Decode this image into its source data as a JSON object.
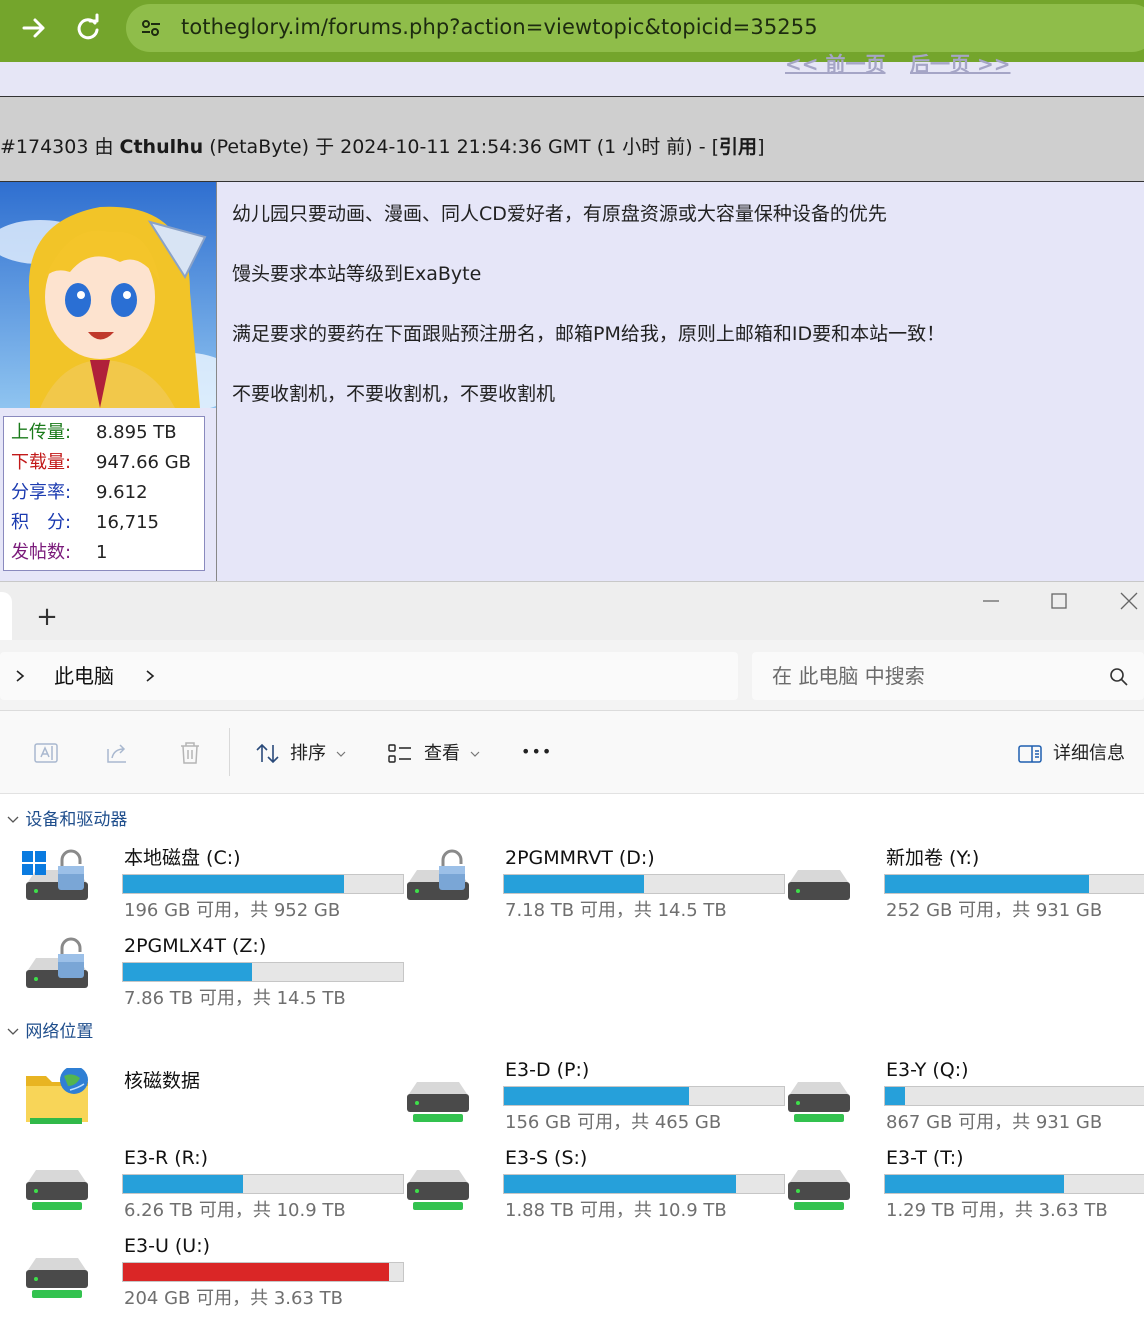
{
  "browser": {
    "url": "totheglory.im/forums.php?action=viewtopic&topicid=35255"
  },
  "forum": {
    "pager_prev": "<< 前一页",
    "pager_next": "后一页 >>",
    "post_header": {
      "post_id": "#174303 由 ",
      "author": "Cthulhu",
      "after_author": " (PetaByte) 于 2024-10-11 21:54:36 GMT (1 小时 前) - [",
      "quote": "引用",
      "close": "]"
    },
    "stats": [
      {
        "label": "上传量:",
        "value": "8.895 TB",
        "color": "#1a7a1a"
      },
      {
        "label": "下载量:",
        "value": "947.66 GB",
        "color": "#c21a1a"
      },
      {
        "label": "分享率:",
        "value": "9.612",
        "color": "#1a3ab0"
      },
      {
        "label": "积　分:",
        "value": "16,715",
        "color": "#1a3ab0"
      },
      {
        "label": "发帖数:",
        "value": "1",
        "color": "#7a1a7a"
      }
    ],
    "post_lines": [
      "幼儿园只要动画、漫画、同人CD爱好者，有原盘资源或大容量保种设备的优先",
      "馒头要求本站等级到ExaByte",
      "满足要求的要药在下面跟贴预注册名，邮箱PM给我，原则上邮箱和ID要和本站一致！",
      "不要收割机，不要收割机，不要收割机"
    ]
  },
  "explorer": {
    "new_tab": "+",
    "address": {
      "location": "此电脑"
    },
    "search": {
      "placeholder": "在 此电脑 中搜索"
    },
    "toolbar": {
      "sort": "排序",
      "view": "查看",
      "more": "•••",
      "details": "详细信息"
    },
    "groups": [
      {
        "title": "设备和驱动器",
        "drives": [
          {
            "name": "本地磁盘 (C:)",
            "free": "196 GB 可用，共 952 GB",
            "used_fraction": 0.79,
            "icon": "system-drive-locked-icon"
          },
          {
            "name": "2PGMMRVT (D:)",
            "free": "7.18 TB 可用，共 14.5 TB",
            "used_fraction": 0.5,
            "icon": "drive-locked-icon"
          },
          {
            "name": "新加卷 (Y:)",
            "free": "252 GB 可用，共 931 GB",
            "used_fraction": 0.73,
            "icon": "drive-icon"
          },
          {
            "name": "2PGMLX4T (Z:)",
            "free": "7.86 TB 可用，共 14.5 TB",
            "used_fraction": 0.46,
            "icon": "drive-locked-icon"
          }
        ]
      },
      {
        "title": "网络位置",
        "folder": {
          "name": "核磁数据",
          "icon": "network-folder-icon"
        },
        "drives": [
          {
            "name": "E3-D (P:)",
            "free": "156 GB 可用，共 465 GB",
            "used_fraction": 0.66,
            "icon": "network-drive-icon"
          },
          {
            "name": "E3-Y (Q:)",
            "free": "867 GB 可用，共 931 GB",
            "used_fraction": 0.07,
            "icon": "network-drive-icon"
          },
          {
            "name": "E3-R (R:)",
            "free": "6.26 TB 可用，共 10.9 TB",
            "used_fraction": 0.43,
            "icon": "network-drive-icon"
          },
          {
            "name": "E3-S (S:)",
            "free": "1.88 TB 可用，共 10.9 TB",
            "used_fraction": 0.83,
            "icon": "network-drive-icon"
          },
          {
            "name": "E3-T (T:)",
            "free": "1.29 TB 可用，共 3.63 TB",
            "used_fraction": 0.64,
            "icon": "network-drive-icon"
          },
          {
            "name": "E3-U (U:)",
            "free": "204 GB 可用，共 3.63 TB",
            "used_fraction": 0.95,
            "icon": "network-drive-icon",
            "critical": true
          }
        ]
      }
    ]
  }
}
